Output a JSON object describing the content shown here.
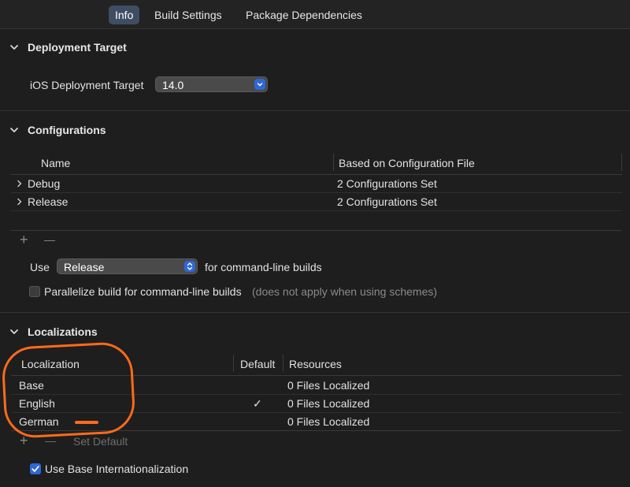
{
  "tabs": [
    {
      "label": "Info",
      "active": true
    },
    {
      "label": "Build Settings",
      "active": false
    },
    {
      "label": "Package Dependencies",
      "active": false
    }
  ],
  "deployment": {
    "title": "Deployment Target",
    "ios_label": "iOS Deployment Target",
    "ios_value": "14.0"
  },
  "configurations": {
    "title": "Configurations",
    "columns": [
      "Name",
      "Based on Configuration File"
    ],
    "rows": [
      {
        "name": "Debug",
        "based_on": "2 Configurations Set"
      },
      {
        "name": "Release",
        "based_on": "2 Configurations Set"
      }
    ],
    "add": "+",
    "remove": "—",
    "use_label": "Use",
    "use_value": "Release",
    "use_suffix": "for command-line builds",
    "parallelize_label": "Parallelize build for command-line builds",
    "parallelize_note": "(does not apply when using schemes)",
    "parallelize_checked": false
  },
  "localizations": {
    "title": "Localizations",
    "columns": [
      "Localization",
      "Default",
      "Resources"
    ],
    "rows": [
      {
        "name": "Base",
        "default": "",
        "resources": "0 Files Localized"
      },
      {
        "name": "English",
        "default": "✓",
        "resources": "0 Files Localized"
      },
      {
        "name": "German",
        "default": "",
        "resources": "0 Files Localized"
      }
    ],
    "add": "+",
    "remove": "—",
    "set_default": "Set Default",
    "base_intl_label": "Use Base Internationalization",
    "base_intl_checked": true
  },
  "colors": {
    "background": "#1e1e1e",
    "accent": "#2e68d8",
    "highlight_annotation": "#ff6a1a"
  }
}
